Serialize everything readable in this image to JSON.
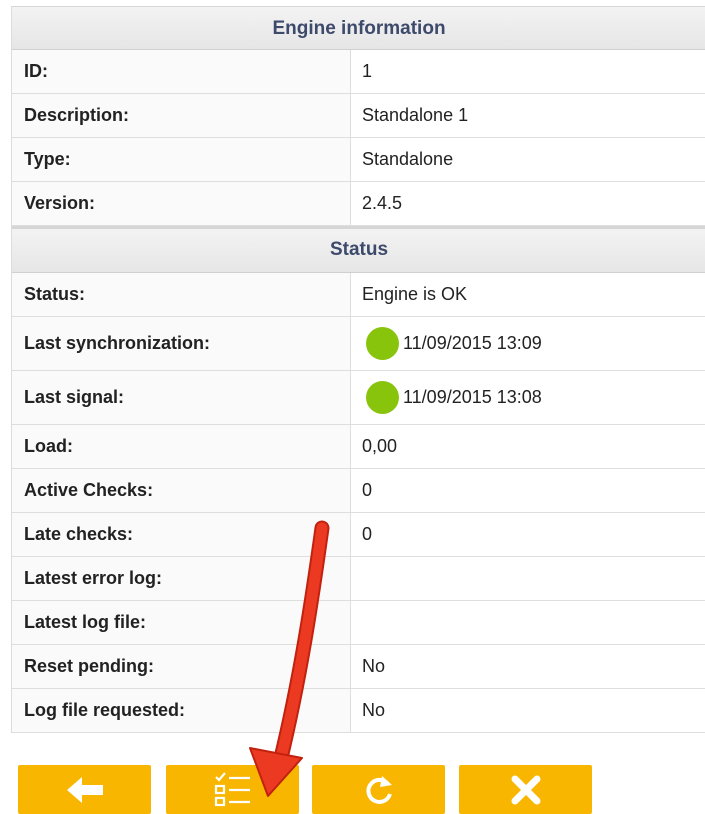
{
  "engine": {
    "header": "Engine information",
    "rows": [
      {
        "label": "ID:",
        "value": "1"
      },
      {
        "label": "Description:",
        "value": "Standalone 1"
      },
      {
        "label": "Type:",
        "value": "Standalone"
      },
      {
        "label": "Version:",
        "value": "2.4.5"
      }
    ]
  },
  "status": {
    "header": "Status",
    "rows": [
      {
        "label": "Status:",
        "value": "Engine is OK"
      },
      {
        "label": "Last synchronization:",
        "value": "11/09/2015 13:09",
        "indicator": "ok-dot-icon"
      },
      {
        "label": "Last signal:",
        "value": "11/09/2015 13:08",
        "indicator": "ok-dot-icon"
      },
      {
        "label": "Load:",
        "value": "0,00"
      },
      {
        "label": "Active Checks:",
        "value": "0"
      },
      {
        "label": "Late checks:",
        "value": "0"
      },
      {
        "label": "Latest error log:",
        "value": ""
      },
      {
        "label": "Latest log file:",
        "value": ""
      },
      {
        "label": "Reset pending:",
        "value": "No"
      },
      {
        "label": "Log file requested:",
        "value": "No"
      }
    ]
  },
  "toolbar": {
    "buttons": [
      {
        "name": "back-button",
        "icon": "arrow-left-icon"
      },
      {
        "name": "checklist-button",
        "icon": "checklist-icon"
      },
      {
        "name": "refresh-button",
        "icon": "refresh-icon"
      },
      {
        "name": "close-button",
        "icon": "close-icon"
      }
    ]
  },
  "colors": {
    "accent": "#f8b600",
    "ok_indicator": "#88c40c",
    "header_text": "#3d4a6b",
    "annotation_arrow": "#e8321c"
  }
}
